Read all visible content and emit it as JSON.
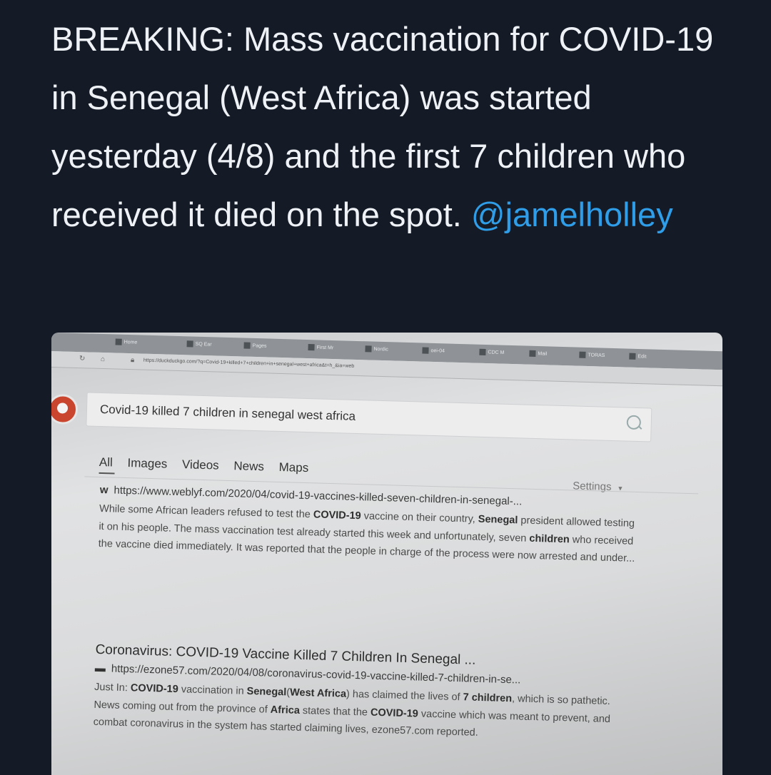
{
  "tweet": {
    "text": "BREAKING: Mass vaccination for COVID-19 in Senegal (West Africa) was started yesterday (4/8) and the first 7 children who received it died on the spot.",
    "mention": "@jamelholley"
  },
  "browser": {
    "tabs": [
      "Home",
      "SQ Ear",
      "Pages",
      "First Mr",
      "Nordic",
      "oei-04",
      "CDC M",
      "Mail",
      "TORAS",
      "Edit"
    ],
    "url": "https://duckduckgo.com/?q=Covid-19+killed+7+children+in+senegal+west+africa&t=h_&ia=web"
  },
  "search": {
    "query": "Covid-19 killed 7 children in senegal west africa",
    "tabs": [
      "All",
      "Images",
      "Videos",
      "News",
      "Maps"
    ],
    "settings_label": "Settings"
  },
  "results": [
    {
      "title": "",
      "site_icon": "w",
      "url": "https://www.weblyf.com/2020/04/covid-19-vaccines-killed-seven-children-in-senegal-...",
      "snippet_parts": [
        {
          "t": "While some African leaders refused to test the ",
          "b": false
        },
        {
          "t": "COVID-19",
          "b": true
        },
        {
          "t": " vaccine on their country, ",
          "b": false
        },
        {
          "t": "Senegal",
          "b": true
        },
        {
          "t": " president allowed testing it on his people. The mass vaccination test already started this week and unfortunately, seven ",
          "b": false
        },
        {
          "t": "children",
          "b": true
        },
        {
          "t": " who received the vaccine died immediately. It was reported that the people in charge of the process were now arrested and under...",
          "b": false
        }
      ]
    },
    {
      "title": "Coronavirus: COVID-19 Vaccine Killed 7 Children In Senegal ...",
      "site_icon": "▬",
      "url": "https://ezone57.com/2020/04/08/coronavirus-covid-19-vaccine-killed-7-children-in-se...",
      "snippet_parts": [
        {
          "t": "Just In: ",
          "b": false
        },
        {
          "t": "COVID-19",
          "b": true
        },
        {
          "t": " vaccination in ",
          "b": false
        },
        {
          "t": "Senegal",
          "b": true
        },
        {
          "t": "(",
          "b": false
        },
        {
          "t": "West Africa",
          "b": true
        },
        {
          "t": ") has claimed the lives of ",
          "b": false
        },
        {
          "t": "7 children",
          "b": true
        },
        {
          "t": ", which is so pathetic. News coming out from the province of ",
          "b": false
        },
        {
          "t": "Africa",
          "b": true
        },
        {
          "t": " states that the ",
          "b": false
        },
        {
          "t": "COVID-19",
          "b": true
        },
        {
          "t": " vaccine which was meant to prevent, and combat coronavirus in the system has started claiming lives, ezone57.com reported.",
          "b": false
        }
      ]
    }
  ]
}
